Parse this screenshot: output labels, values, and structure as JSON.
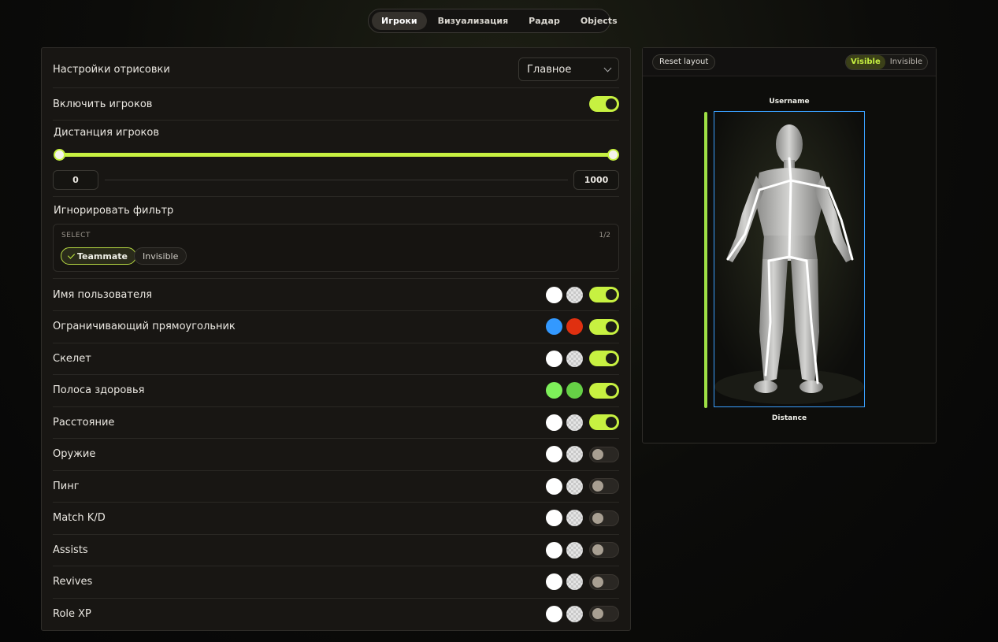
{
  "tabs": [
    "Игроки",
    "Визуализация",
    "Радар",
    "Objects"
  ],
  "active_tab": "Игроки",
  "settings": {
    "draw_settings_label": "Настройки отрисовки",
    "draw_settings_value": "Главное",
    "enable_players_label": "Включить игроков",
    "enable_players": true,
    "distance_label": "Дистанция игроков",
    "distance_min": "0",
    "distance_max": "1000",
    "ignore_filter_label": "Игнорировать фильтр",
    "filter": {
      "head": "SELECT",
      "count": "1/2",
      "chips": [
        {
          "label": "Teammate",
          "selected": true
        },
        {
          "label": "Invisible",
          "selected": false
        }
      ]
    }
  },
  "options": [
    {
      "label": "Имя пользователя",
      "colors": [
        "#ffffff",
        "checker"
      ],
      "enabled": true
    },
    {
      "label": "Ограничивающий прямоугольник",
      "colors": [
        "#3399ff",
        "#e03010"
      ],
      "enabled": true
    },
    {
      "label": "Скелет",
      "colors": [
        "#ffffff",
        "checker"
      ],
      "enabled": true
    },
    {
      "label": "Полоса здоровья",
      "colors": [
        "#7ef05a",
        "#66d046"
      ],
      "enabled": true
    },
    {
      "label": "Расстояние",
      "colors": [
        "#ffffff",
        "checker"
      ],
      "enabled": true
    },
    {
      "label": "Оружие",
      "colors": [
        "#ffffff",
        "checker"
      ],
      "enabled": false
    },
    {
      "label": "Пинг",
      "colors": [
        "#ffffff",
        "checker"
      ],
      "enabled": false
    },
    {
      "label": "Match K/D",
      "colors": [
        "#ffffff",
        "checker"
      ],
      "enabled": false
    },
    {
      "label": "Assists",
      "colors": [
        "#ffffff",
        "checker"
      ],
      "enabled": false
    },
    {
      "label": "Revives",
      "colors": [
        "#ffffff",
        "checker"
      ],
      "enabled": false
    },
    {
      "label": "Role XP",
      "colors": [
        "#ffffff",
        "checker"
      ],
      "enabled": false
    }
  ],
  "preview": {
    "reset_label": "Reset layout",
    "visible_label": "Visible",
    "invisible_label": "Invisible",
    "username": "Username",
    "distance": "Distance"
  },
  "colors": {
    "accent": "#c7f141",
    "bbox": "#3aa0ff",
    "health": "#9ee045"
  }
}
